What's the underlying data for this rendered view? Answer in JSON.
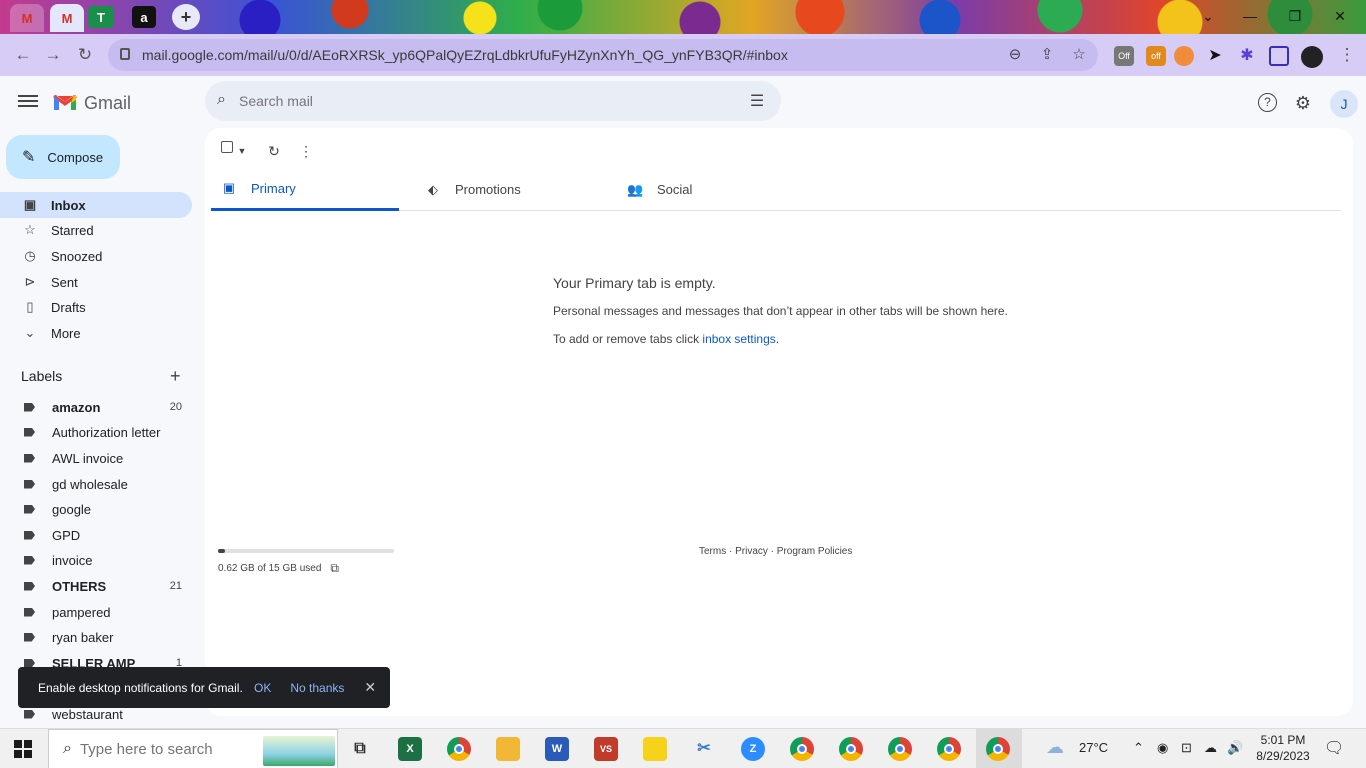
{
  "browser": {
    "tabs": [
      {
        "label": "M",
        "active": false
      },
      {
        "label": "M",
        "active": true
      },
      {
        "label": "T",
        "active": false
      },
      {
        "label": "a",
        "active": false
      }
    ],
    "new_tab": "+",
    "url": "mail.google.com/mail/u/0/d/AEoRXRSk_yp6QPalQyEZrqLdbkrUfuFyHZynXnYh_QG_ynFYB3QR/#inbox",
    "extensions": [
      {
        "name": "extension-off-badge",
        "label": "Off",
        "color": "#7a7a7a"
      },
      {
        "name": "extension-off-orange",
        "label": "off",
        "color": "#e08a1e"
      },
      {
        "name": "extension-circle",
        "label": "",
        "color": "#f18c3a"
      },
      {
        "name": "extension-cursor",
        "label": "",
        "color": "#1a1a1a"
      },
      {
        "name": "extensions-puzzle",
        "label": "",
        "color": "#5b3fd6"
      },
      {
        "name": "extension-sidebar",
        "label": "",
        "color": "#3b2db8"
      },
      {
        "name": "extension-globe",
        "label": "",
        "color": "#222222"
      }
    ]
  },
  "gmail": {
    "logo_text": "Gmail",
    "search_placeholder": "Search mail",
    "compose_label": "Compose",
    "nav": [
      {
        "label": "Inbox",
        "icon": "inbox-icon",
        "glyph": "▣",
        "selected": true
      },
      {
        "label": "Starred",
        "icon": "star-icon",
        "glyph": "☆",
        "selected": false
      },
      {
        "label": "Snoozed",
        "icon": "clock-icon",
        "glyph": "◷",
        "selected": false
      },
      {
        "label": "Sent",
        "icon": "send-icon",
        "glyph": "⊳",
        "selected": false
      },
      {
        "label": "Drafts",
        "icon": "draft-icon",
        "glyph": "▯",
        "selected": false
      },
      {
        "label": "More",
        "icon": "chevron-down-icon",
        "glyph": "⌄",
        "selected": false
      }
    ],
    "labels_title": "Labels",
    "labels": [
      {
        "label": "amazon",
        "count": "20",
        "bold": true
      },
      {
        "label": "Authorization letter",
        "count": "",
        "bold": false
      },
      {
        "label": "AWL invoice",
        "count": "",
        "bold": false
      },
      {
        "label": "gd wholesale",
        "count": "",
        "bold": false
      },
      {
        "label": "google",
        "count": "",
        "bold": false
      },
      {
        "label": "GPD",
        "count": "",
        "bold": false
      },
      {
        "label": "invoice",
        "count": "",
        "bold": false
      },
      {
        "label": "OTHERS",
        "count": "21",
        "bold": true
      },
      {
        "label": "pampered",
        "count": "",
        "bold": false
      },
      {
        "label": "ryan baker",
        "count": "",
        "bold": false
      },
      {
        "label": "SELLER AMP",
        "count": "1",
        "bold": true
      },
      {
        "label": "webstaurant",
        "count": "",
        "bold": false
      }
    ],
    "category_tabs": [
      {
        "label": "Primary",
        "icon": "inbox-tab-icon",
        "glyph": "▣",
        "selected": true
      },
      {
        "label": "Promotions",
        "icon": "tag-icon",
        "glyph": "⬖",
        "selected": false
      },
      {
        "label": "Social",
        "icon": "people-icon",
        "glyph": "👥",
        "selected": false
      }
    ],
    "empty": {
      "title": "Your Primary tab is empty.",
      "line1": "Personal messages and messages that don’t appear in other tabs will be shown here.",
      "line2_prefix": "To add or remove tabs click ",
      "line2_link": "inbox settings",
      "line2_suffix": "."
    },
    "storage": {
      "text": "0.62 GB of 15 GB used",
      "used_fraction": 0.04
    },
    "footer": "Terms · Privacy · Program Policies",
    "avatar_initial": "J"
  },
  "toast": {
    "message": "Enable desktop notifications for Gmail.",
    "ok": "OK",
    "no_thanks": "No thanks",
    "close": "✕"
  },
  "taskbar": {
    "search_placeholder": "Type here to search",
    "weather": "27°C",
    "time": "5:01 PM",
    "date": "8/29/2023",
    "apps": [
      {
        "name": "task-view-icon",
        "label": "⧉",
        "color": "#333333"
      },
      {
        "name": "excel-icon",
        "label": "X",
        "color": "#1d7044"
      },
      {
        "name": "chrome-icon",
        "label": "",
        "color": ""
      },
      {
        "name": "file-explorer-icon",
        "label": "",
        "color": "#f2b735"
      },
      {
        "name": "word-icon",
        "label": "W",
        "color": "#2b5bb8"
      },
      {
        "name": "vs-app-icon",
        "label": "VS",
        "color": "#c23a2a"
      },
      {
        "name": "sticky-notes-icon",
        "label": "",
        "color": "#f7d21b"
      },
      {
        "name": "snipping-icon",
        "label": "✂",
        "color": "#3e7cc3"
      },
      {
        "name": "zoom-icon",
        "label": "Z",
        "color": "#2d8cff"
      },
      {
        "name": "chrome-profile-1-icon",
        "label": "",
        "color": ""
      },
      {
        "name": "chrome-profile-2-icon",
        "label": "",
        "color": ""
      },
      {
        "name": "chrome-profile-3-icon",
        "label": "",
        "color": ""
      },
      {
        "name": "chrome-profile-4-icon",
        "label": "",
        "color": ""
      },
      {
        "name": "chrome-profile-5-icon",
        "label": "",
        "color": ""
      }
    ]
  }
}
